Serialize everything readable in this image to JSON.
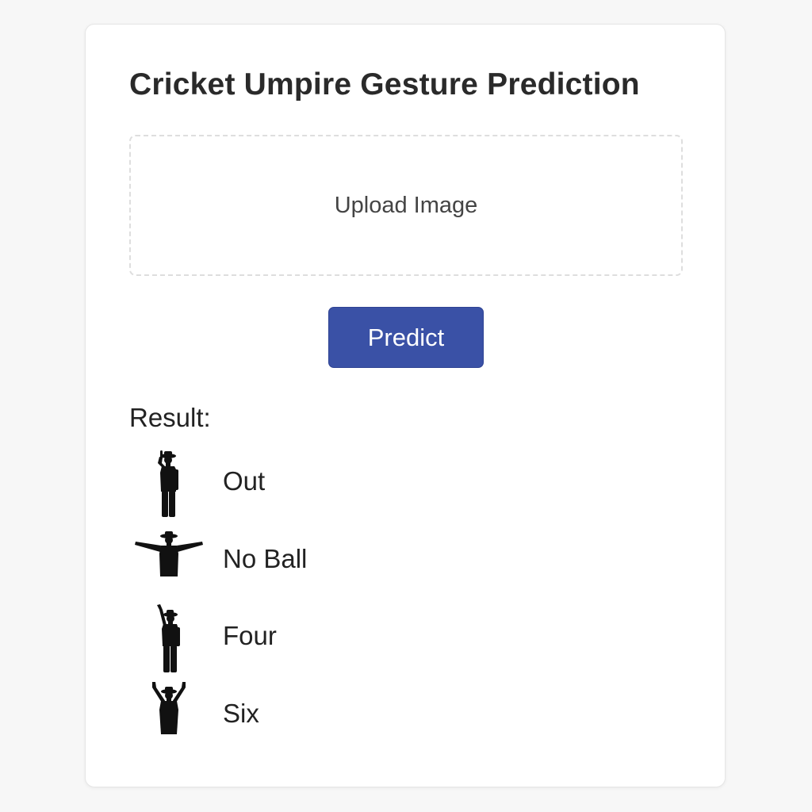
{
  "page": {
    "title": "Cricket Umpire Gesture Prediction"
  },
  "upload": {
    "label": "Upload Image"
  },
  "predict_button": {
    "label": "Predict"
  },
  "result": {
    "heading": "Result:",
    "items": [
      {
        "label": "Out",
        "icon": "umpire-out-signal-icon"
      },
      {
        "label": "No Ball",
        "icon": "umpire-no-ball-signal-icon"
      },
      {
        "label": "Four",
        "icon": "umpire-four-signal-icon"
      },
      {
        "label": "Six",
        "icon": "umpire-six-signal-icon"
      }
    ]
  },
  "colors": {
    "page_background": "#f7f7f7",
    "card_background": "#ffffff",
    "primary_button": "#3a51a6",
    "text": "#222222",
    "upload_border": "#dedede"
  }
}
